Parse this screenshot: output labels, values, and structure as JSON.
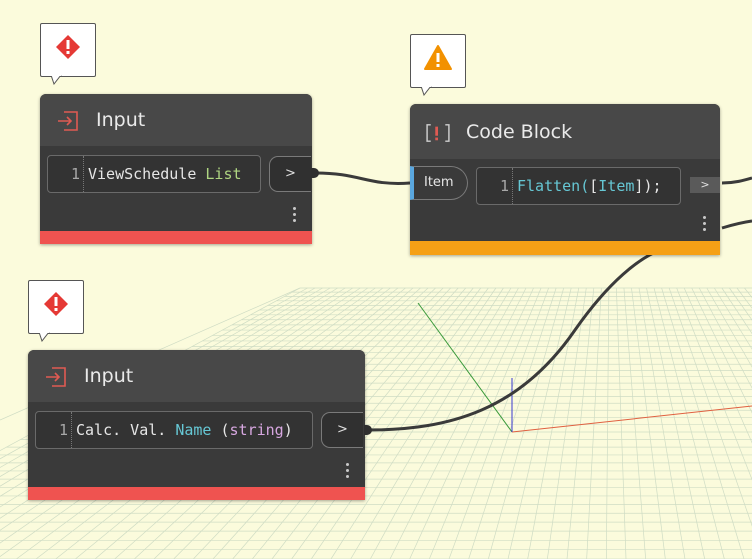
{
  "canvas": {
    "background": "#fbfbdc",
    "grid_color": "#cfdcc4",
    "wire_color": "#3a3a3a"
  },
  "nodes": {
    "input_top": {
      "title": "Input",
      "line_number": "1",
      "code_tokens": [
        "ViewSchedule ",
        "List"
      ],
      "output_label": ">",
      "status": "error",
      "status_color": "#ef5350"
    },
    "code_block": {
      "title": "Code Block",
      "icon_text": "[]",
      "input_port_label": "Item",
      "line_number": "1",
      "code_tokens": [
        "Flatten(",
        "[",
        "Item",
        "]",
        ");"
      ],
      "output_label": ">",
      "status": "warning",
      "status_color": "#f5a016"
    },
    "input_bottom": {
      "title": "Input",
      "line_number": "1",
      "code_tokens": [
        "Calc. Val. ",
        "Name",
        " (",
        "string",
        ")"
      ],
      "output_label": ">",
      "status": "error",
      "status_color": "#ef5350"
    }
  },
  "callouts": {
    "error_top": {
      "icon": "error-icon",
      "color": "#e53935"
    },
    "warning": {
      "icon": "warning-icon",
      "color": "#f29100"
    },
    "error_bottom": {
      "icon": "error-icon",
      "color": "#e53935"
    }
  }
}
